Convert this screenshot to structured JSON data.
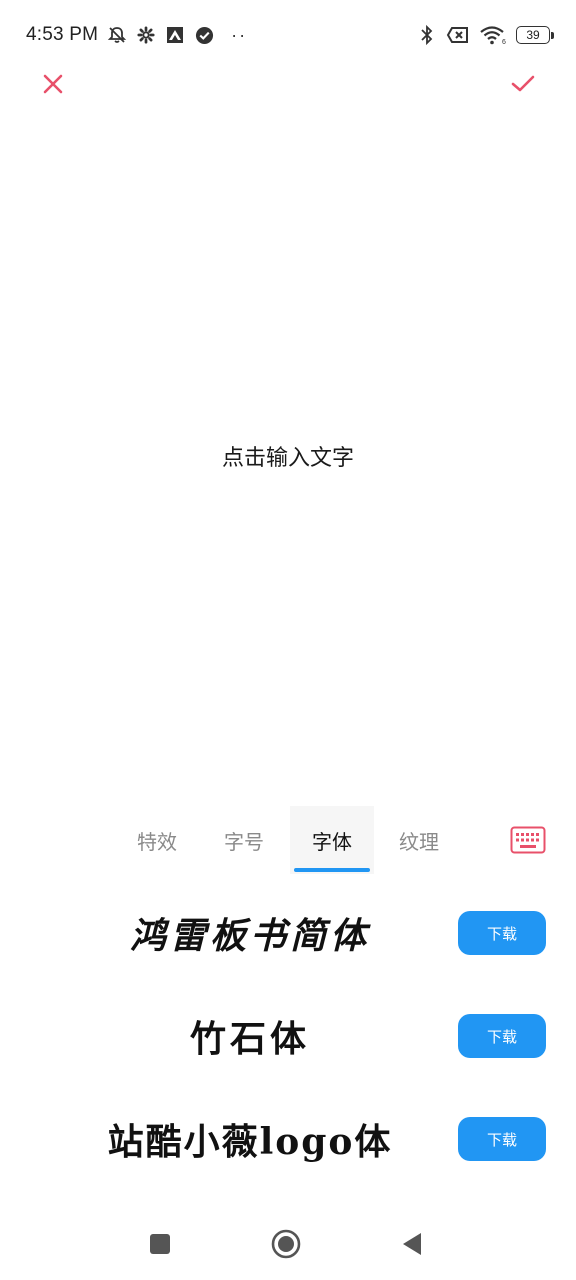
{
  "status_bar": {
    "time": "4:53 PM",
    "battery_level": "39",
    "icons": [
      "mute-icon",
      "gear-icon",
      "app-icon",
      "check-circle-icon",
      "more-dots-icon",
      "bluetooth-icon",
      "sim-x-icon",
      "wifi-icon",
      "battery-icon"
    ]
  },
  "toolbar": {
    "close_icon": "close-icon",
    "confirm_icon": "check-icon",
    "accent_color": "#e8506a"
  },
  "canvas": {
    "placeholder": "点击输入文字"
  },
  "tabs": [
    {
      "label": "特效",
      "active": false
    },
    {
      "label": "字号",
      "active": false
    },
    {
      "label": "字体",
      "active": true
    },
    {
      "label": "纹理",
      "active": false
    }
  ],
  "keyboard_icon": "keyboard-icon",
  "fonts": [
    {
      "name": "鸿雷板书简体",
      "action": "下载"
    },
    {
      "name": "竹石体",
      "action": "下载"
    },
    {
      "name": "站酷小薇logo体",
      "action": "下载"
    }
  ],
  "colors": {
    "accent_blue": "#2196f3",
    "accent_red": "#e8506a"
  },
  "nav_bar": {
    "icons": [
      "square-icon",
      "circle-icon",
      "back-triangle-icon"
    ]
  }
}
